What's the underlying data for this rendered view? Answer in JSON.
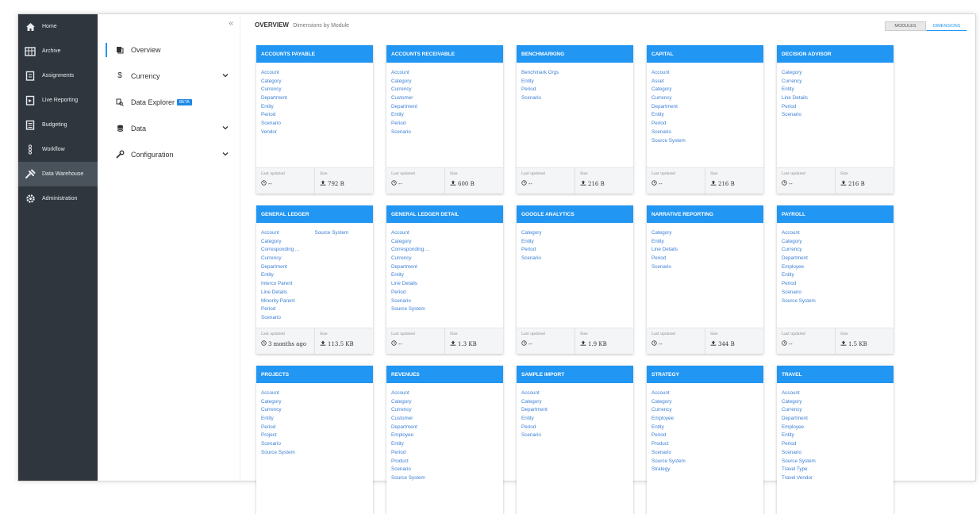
{
  "nav": {
    "items": [
      {
        "label": "Home",
        "icon": "home-icon"
      },
      {
        "label": "Archive",
        "icon": "archive-icon"
      },
      {
        "label": "Assignments",
        "icon": "assignments-icon"
      },
      {
        "label": "Live Reporting",
        "icon": "live-reporting-icon"
      },
      {
        "label": "Budgeting",
        "icon": "budgeting-icon"
      },
      {
        "label": "Workflow",
        "icon": "workflow-icon"
      },
      {
        "label": "Data Warehouse",
        "icon": "tools-icon",
        "active": true
      },
      {
        "label": "Administration",
        "icon": "gear-icon"
      }
    ]
  },
  "subnav": {
    "collapse_glyph": "«",
    "items": [
      {
        "label": "Overview",
        "icon": "overview-icon",
        "active": true
      },
      {
        "label": "Currency",
        "icon": "currency-icon",
        "glyph": "$",
        "expandable": true
      },
      {
        "label": "Data Explorer",
        "icon": "data-explorer-icon",
        "badge": "BETA"
      },
      {
        "label": "Data",
        "icon": "database-icon",
        "expandable": true
      },
      {
        "label": "Configuration",
        "icon": "wrench-icon",
        "expandable": true
      }
    ]
  },
  "header": {
    "title": "OVERVIEW",
    "subtitle": "Dimensions by Module",
    "toggle": {
      "modules": "MODULES",
      "dimensions": "DIMENSIONS",
      "selected": "dimensions"
    }
  },
  "footer_labels": {
    "last_updated": "Last updated",
    "size": "Size"
  },
  "colors": {
    "accent": "#2196f3",
    "sidebar": "#2f363d",
    "link": "#3b7fd4"
  },
  "modules": [
    {
      "name": "ACCOUNTS PAYABLE",
      "dimensions": [
        "Account",
        "Category",
        "Currency",
        "Department",
        "Entity",
        "Period",
        "Scenario",
        "Vendor"
      ],
      "last_updated": "--",
      "size": "792 B"
    },
    {
      "name": "ACCOUNTS RECEIVABLE",
      "dimensions": [
        "Account",
        "Category",
        "Currency",
        "Customer",
        "Department",
        "Entity",
        "Period",
        "Scenario"
      ],
      "last_updated": "--",
      "size": "600 B"
    },
    {
      "name": "BENCHMARKING",
      "dimensions": [
        "Benchmark Orgs",
        "Entity",
        "Period",
        "Scenario"
      ],
      "last_updated": "--",
      "size": "216 B"
    },
    {
      "name": "CAPITAL",
      "dimensions": [
        "Account",
        "Asset",
        "Category",
        "Currency",
        "Department",
        "Entity",
        "Period",
        "Scenario",
        "Source System"
      ],
      "last_updated": "--",
      "size": "216 B"
    },
    {
      "name": "DECISION ADVISOR",
      "dimensions": [
        "Category",
        "Currency",
        "Entity",
        "Line Details",
        "Period",
        "Scenario"
      ],
      "last_updated": "--",
      "size": "216 B"
    },
    {
      "name": "GENERAL LEDGER",
      "dimensions": [
        "Account",
        "Category",
        "Corresponding ...",
        "Currency",
        "Department",
        "Entity",
        "Interco Parent",
        "Line Details",
        "Minority Parent",
        "Period",
        "Scenario",
        "Source System"
      ],
      "last_updated": "3 months ago",
      "size": "113.5 KB"
    },
    {
      "name": "GENERAL LEDGER DETAIL",
      "dimensions": [
        "Account",
        "Category",
        "Corresponding ...",
        "Currency",
        "Department",
        "Entity",
        "Line Details",
        "Period",
        "Scenario",
        "Source System"
      ],
      "last_updated": "--",
      "size": "1.3 KB"
    },
    {
      "name": "GOOGLE ANALYTICS",
      "dimensions": [
        "Category",
        "Entity",
        "Period",
        "Scenario"
      ],
      "last_updated": "--",
      "size": "1.9 KB"
    },
    {
      "name": "NARRATIVE REPORTING",
      "dimensions": [
        "Category",
        "Entity",
        "Line Details",
        "Period",
        "Scenario"
      ],
      "last_updated": "--",
      "size": "344 B"
    },
    {
      "name": "PAYROLL",
      "dimensions": [
        "Account",
        "Category",
        "Currency",
        "Department",
        "Employee",
        "Entity",
        "Period",
        "Scenario",
        "Source System"
      ],
      "last_updated": "--",
      "size": "1.5 KB"
    },
    {
      "name": "PROJECTS",
      "dimensions": [
        "Account",
        "Category",
        "Currency",
        "Entity",
        "Period",
        "Project",
        "Scenario",
        "Source System"
      ],
      "last_updated": "",
      "size": ""
    },
    {
      "name": "REVENUES",
      "dimensions": [
        "Account",
        "Category",
        "Currency",
        "Customer",
        "Department",
        "Employee",
        "Entity",
        "Period",
        "Product",
        "Scenario",
        "Source System"
      ],
      "last_updated": "",
      "size": ""
    },
    {
      "name": "SAMPLE IMPORT",
      "dimensions": [
        "Account",
        "Category",
        "Department",
        "Entity",
        "Period",
        "Scenario"
      ],
      "last_updated": "",
      "size": ""
    },
    {
      "name": "STRATEGY",
      "dimensions": [
        "Account",
        "Category",
        "Currency",
        "Employee",
        "Entity",
        "Period",
        "Product",
        "Scenario",
        "Source System",
        "Strategy"
      ],
      "last_updated": "",
      "size": ""
    },
    {
      "name": "TRAVEL",
      "dimensions": [
        "Account",
        "Category",
        "Currency",
        "Department",
        "Employee",
        "Entity",
        "Period",
        "Scenario",
        "Source System",
        "Travel Type",
        "Travel Vendor"
      ],
      "last_updated": "",
      "size": ""
    }
  ]
}
